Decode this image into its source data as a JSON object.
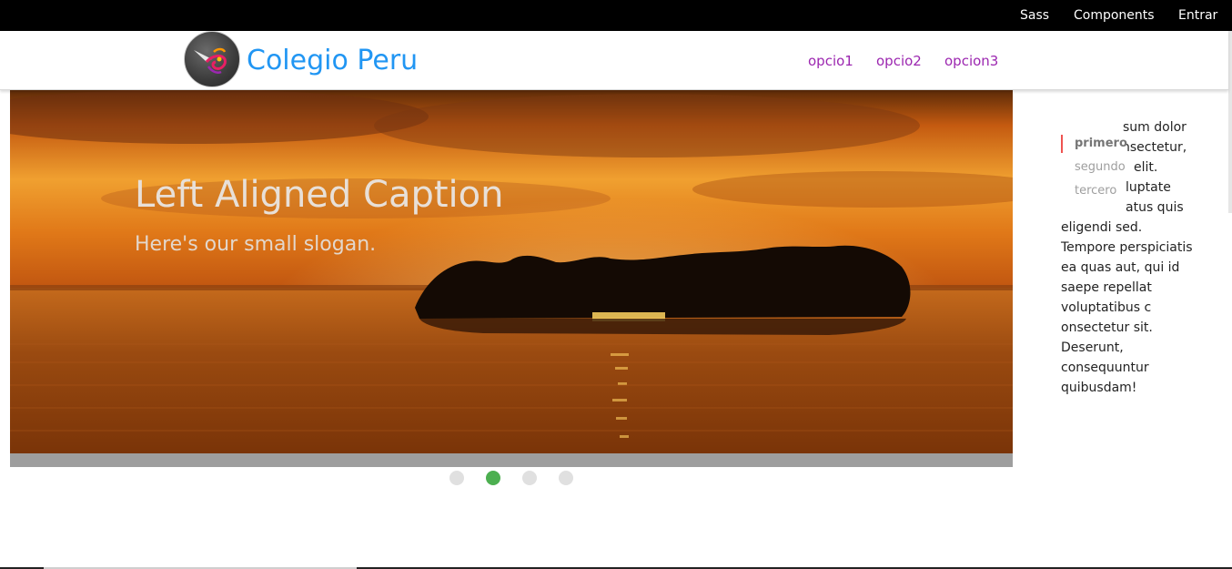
{
  "topbar": {
    "links": [
      "Sass",
      "Components",
      "Entrar"
    ]
  },
  "navbar": {
    "brand": "Colegio Peru",
    "links": [
      "opcio1",
      "opcio2",
      "opcion3"
    ]
  },
  "slider": {
    "caption_title": "Left Aligned Caption",
    "caption_subtitle": "Here's our small slogan.",
    "slide_count": 4,
    "active_index": 1
  },
  "sidebar_text": {
    "lines": [
      "sum dolor",
      "nsectetur,",
      "elit.",
      "luptate",
      "atus quis",
      "eligendi sed.",
      "Tempore perspiciatis",
      "ea quas aut, qui id",
      "saepe repellat",
      "voluptatibus c",
      "onsectetur sit.",
      "Deserunt,",
      "consequuntur",
      "quibusdam!"
    ]
  },
  "toc": {
    "items": [
      "primero",
      "segundo",
      "tercero"
    ],
    "active_index": 0
  },
  "colors": {
    "topbar_bg": "#000000",
    "brand": "#2196f3",
    "nav_link": "#9c27b0",
    "indicator_active": "#4caf50",
    "indicator_inactive": "#e0e0e0",
    "toc_marker": "#ef5350"
  }
}
